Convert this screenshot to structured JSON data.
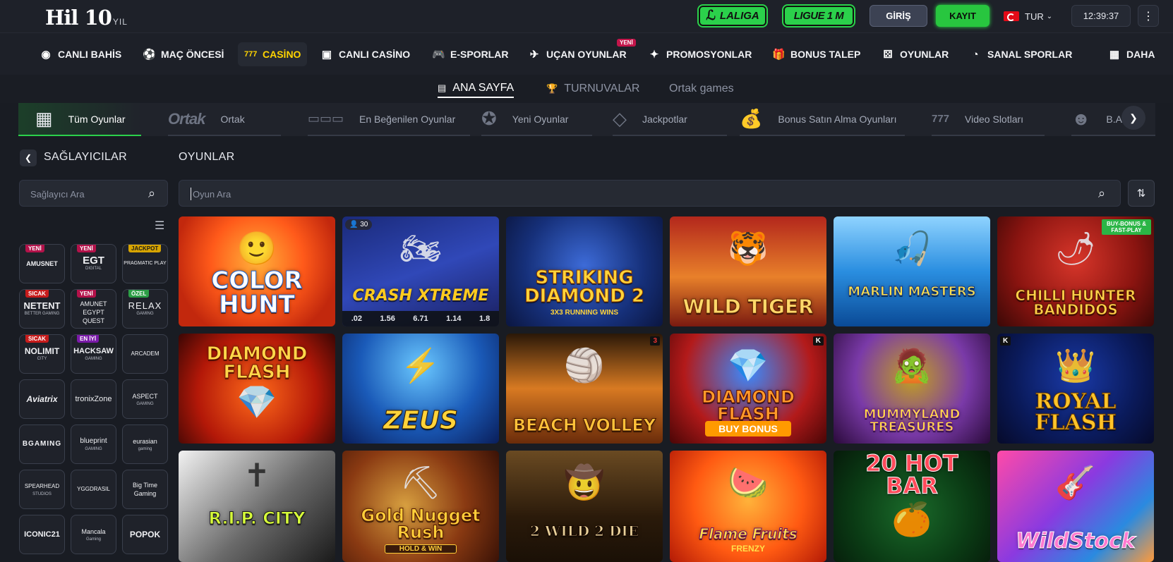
{
  "topbar": {
    "logo_brand": "Hil 10",
    "logo_sub": "YIL",
    "laliga_label": "LALIGA",
    "laliga_mark": "ℒ",
    "ligue_label": "LIGUE 1 M",
    "login_label": "GİRİŞ",
    "register_label": "KAYIT",
    "language": "TUR",
    "clock": "12:39:37"
  },
  "main_nav": {
    "new_badge": "YENİ",
    "items": [
      {
        "label": "CANLI BAHİS",
        "icon": "live-icon"
      },
      {
        "label": "MAÇ ÖNCESİ",
        "icon": "soccer-ball-icon"
      },
      {
        "label": "CASİNO",
        "icon": "slot-777-icon"
      },
      {
        "label": "CANLI CASİNO",
        "icon": "dealer-icon"
      },
      {
        "label": "E-SPORLAR",
        "icon": "gamepad-icon"
      },
      {
        "label": "UÇAN OYUNLAR",
        "icon": "plane-icon"
      },
      {
        "label": "PROMOSYONLAR",
        "icon": "promo-icon"
      },
      {
        "label": "BONUS TALEP",
        "icon": "gift-icon"
      },
      {
        "label": "OYUNLAR",
        "icon": "dice-icon"
      },
      {
        "label": "SANAL SPORLAR",
        "icon": "virtual-icon"
      },
      {
        "label": "DAHA",
        "icon": "grid-icon"
      }
    ]
  },
  "sub_nav": {
    "items": [
      {
        "label": "ANA SAYFA"
      },
      {
        "label": "TURNUVALAR"
      },
      {
        "label": "Ortak games"
      }
    ]
  },
  "categories": {
    "ortak_logo": "Ortak",
    "items": [
      {
        "label": "Tüm Oyunlar"
      },
      {
        "label": "Ortak"
      },
      {
        "label": "En Beğenilen Oyunlar"
      },
      {
        "label": "Yeni Oyunlar"
      },
      {
        "label": "Jackpotlar"
      },
      {
        "label": "Bonus Satın Alma Oyunları"
      },
      {
        "label": "Video Slotları"
      },
      {
        "label": "B.Ar"
      }
    ]
  },
  "providers": {
    "title": "SAĞLAYICILAR",
    "search_placeholder": "Sağlayıcı Ara",
    "items": [
      {
        "name": "AMUSNET",
        "sub": "",
        "badge": "YENİ"
      },
      {
        "name": "EGT",
        "sub": "DIGITAL",
        "badge": "YENİ"
      },
      {
        "name": "PRAGMATIC PLAY",
        "sub": "",
        "badge": "JACKPOT"
      },
      {
        "name": "NETENT",
        "sub": "BETTER GAMING",
        "badge": "SICAK"
      },
      {
        "name": "AMUNET EGYPT QUEST",
        "sub": "",
        "badge": "YENİ"
      },
      {
        "name": "RELAX",
        "sub": "GAMING",
        "badge": "ÖZEL"
      },
      {
        "name": "NOLIMIT",
        "sub": "CITY",
        "badge": "SICAK"
      },
      {
        "name": "HACKSAW",
        "sub": "GAMING",
        "badge": "EN İYİ"
      },
      {
        "name": "ARCADEM",
        "sub": "",
        "badge": ""
      },
      {
        "name": "Aviatrix",
        "sub": "",
        "badge": ""
      },
      {
        "name": "tronixZone",
        "sub": "",
        "badge": ""
      },
      {
        "name": "ASPECT",
        "sub": "GAMING",
        "badge": ""
      },
      {
        "name": "BGAMING",
        "sub": "",
        "badge": ""
      },
      {
        "name": "blueprint",
        "sub": "GAMING",
        "badge": ""
      },
      {
        "name": "eurasian",
        "sub": "gaming",
        "badge": ""
      },
      {
        "name": "SPEARHEAD",
        "sub": "STUDIOS",
        "badge": ""
      },
      {
        "name": "YGGDRASIL",
        "sub": "",
        "badge": ""
      },
      {
        "name": "Big Time Gaming",
        "sub": "",
        "badge": ""
      },
      {
        "name": "ICONIC21",
        "sub": "",
        "badge": ""
      },
      {
        "name": "Mancala",
        "sub": "Gaming",
        "badge": ""
      },
      {
        "name": "POPOK",
        "sub": "",
        "badge": ""
      }
    ]
  },
  "games": {
    "title": "OYUNLAR",
    "search_placeholder": "Oyun Ara",
    "items": [
      {
        "title": "COLOR HUNT",
        "sub": "",
        "badge": "",
        "corner": ""
      },
      {
        "title": "CRASH XTREME",
        "sub": "",
        "badge": "30",
        "corner": ""
      },
      {
        "title": "STRIKING DIAMOND 2",
        "sub": "3X3 RUNNING WINS",
        "badge": "",
        "corner": ""
      },
      {
        "title": "WILD TIGER",
        "sub": "",
        "badge": "",
        "corner": ""
      },
      {
        "title": "MARLIN MASTERS",
        "sub": "",
        "badge": "",
        "corner": ""
      },
      {
        "title": "CHILLI HUNTER BANDIDOS",
        "sub": "",
        "badge": "",
        "corner": "BUY-BONUS & FAST-PLAY"
      },
      {
        "title": "DIAMOND FLASH",
        "sub": "",
        "badge": "",
        "corner": ""
      },
      {
        "title": "ZEUS",
        "sub": "",
        "badge": "",
        "corner": ""
      },
      {
        "title": "BEACH VOLLEY",
        "sub": "",
        "badge": "",
        "corner": "3"
      },
      {
        "title": "DIAMOND FLASH",
        "sub": "BUY BONUS",
        "badge": "",
        "corner": "K"
      },
      {
        "title": "MUMMYLAND TREASURES",
        "sub": "",
        "badge": "",
        "corner": ""
      },
      {
        "title": "ROYAL FLASH",
        "sub": "",
        "badge": "",
        "corner": "K"
      },
      {
        "title": "R.I.P. CITY",
        "sub": "",
        "badge": "",
        "corner": ""
      },
      {
        "title": "Gold Nugget Rush",
        "sub": "HOLD & WIN",
        "badge": "",
        "corner": ""
      },
      {
        "title": "2 WILD 2 DIE",
        "sub": "",
        "badge": "",
        "corner": ""
      },
      {
        "title": "Flame Fruits",
        "sub": "FRENZY",
        "badge": "",
        "corner": ""
      },
      {
        "title": "20 HOT BAR",
        "sub": "",
        "badge": "",
        "corner": ""
      },
      {
        "title": "WildStock",
        "sub": "",
        "badge": "",
        "corner": ""
      }
    ],
    "crash_multipliers": [
      ".02",
      "1.56",
      "6.71",
      "1.14",
      "1.8"
    ]
  }
}
